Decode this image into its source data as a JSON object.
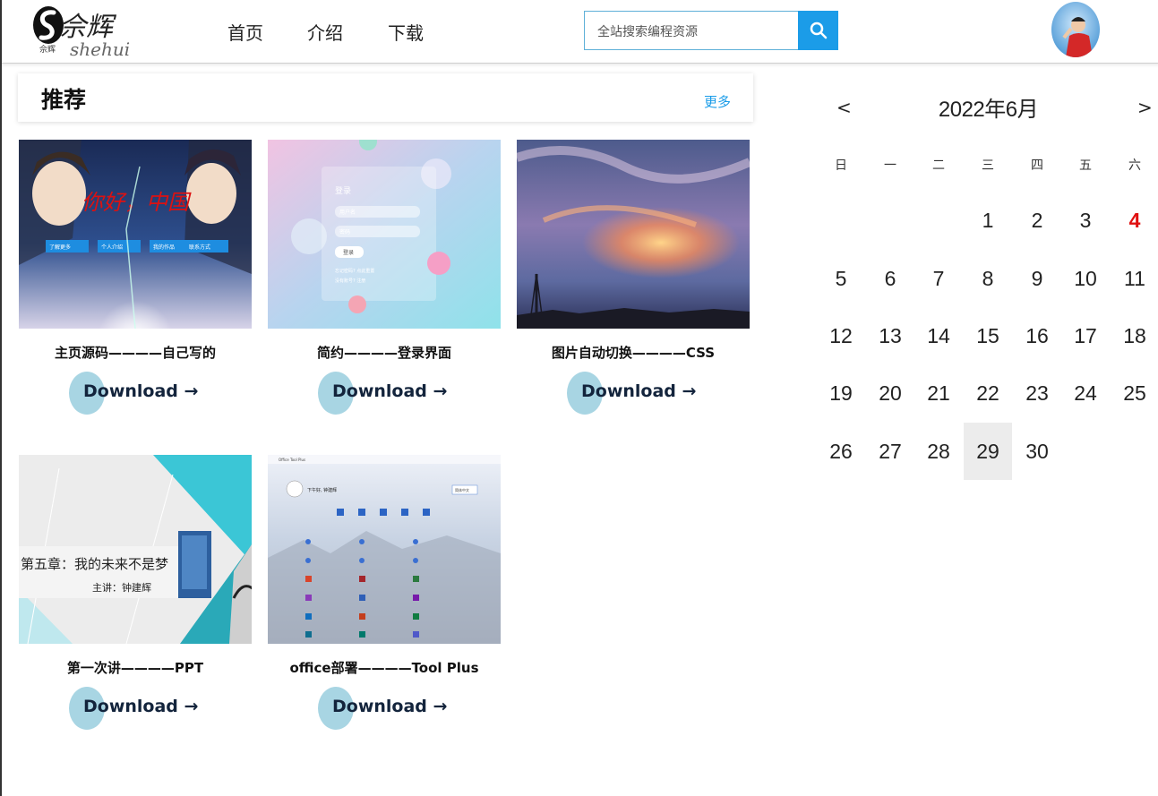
{
  "header": {
    "logo_text": "佘辉",
    "logo_sub": "shehui",
    "nav": [
      "首页",
      "介绍",
      "下载"
    ],
    "search_placeholder": "全站搜索编程资源"
  },
  "recommend": {
    "title": "推荐",
    "more": "更多"
  },
  "cards": [
    {
      "caption": "主页源码————自己写的",
      "download": "Download →",
      "thumb": "anime-homepage",
      "thumb_text": {
        "title": "你好，中国",
        "buttons": [
          "了解更多",
          "个人介绍",
          "我的作品",
          "联系方式"
        ]
      }
    },
    {
      "caption": "简约————登录界面",
      "download": "Download →",
      "thumb": "login-ui",
      "thumb_text": {
        "title": "登录",
        "user": "用户名",
        "pass": "密码",
        "btn": "登录",
        "l1": "忘记密码? 点此重置",
        "l2": "没有账号? 注册"
      }
    },
    {
      "caption": "图片自动切换————CSS",
      "download": "Download →",
      "thumb": "sunset-sky"
    },
    {
      "caption": "第一次讲————PPT",
      "download": "Download →",
      "thumb": "ppt-slide",
      "thumb_text": {
        "title": "第五章：我的未来不是梦",
        "sub": "主讲：钟建辉"
      }
    },
    {
      "caption": "office部署————Tool Plus",
      "download": "Download →",
      "thumb": "office-tool-plus",
      "thumb_text": {
        "window": "Office Tool Plus",
        "greeting": "下午好, 钟建辉",
        "lang": "简体中文"
      }
    }
  ],
  "calendar": {
    "title": "2022年6月",
    "prev": "<",
    "next": ">",
    "weekdays": [
      "日",
      "一",
      "二",
      "三",
      "四",
      "五",
      "六"
    ],
    "days": [
      "1",
      "2",
      "3",
      "4",
      "5",
      "6",
      "7",
      "8",
      "9",
      "10",
      "11",
      "12",
      "13",
      "14",
      "15",
      "16",
      "17",
      "18",
      "19",
      "20",
      "21",
      "22",
      "23",
      "24",
      "25",
      "26",
      "27",
      "28",
      "29",
      "30"
    ],
    "today": "29",
    "highlight_day": "4",
    "highlight_color": "#e01010"
  },
  "colors": {
    "accent": "#1b9ce8",
    "download_circle": "#a8d5e3"
  }
}
